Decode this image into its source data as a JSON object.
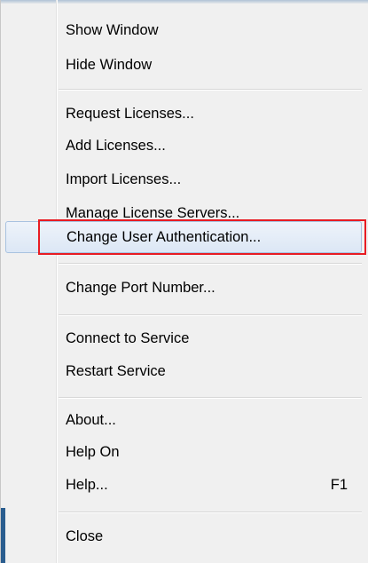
{
  "menu": {
    "items": {
      "show_window": "Show Window",
      "hide_window": "Hide Window",
      "request_licenses": "Request Licenses...",
      "add_licenses": "Add Licenses...",
      "import_licenses": "Import Licenses...",
      "manage_license_servers": "Manage License Servers...",
      "change_user_auth": "Change User Authentication...",
      "change_port_number": "Change Port Number...",
      "connect_to_service": "Connect to Service",
      "restart_service": "Restart Service",
      "about": "About...",
      "help_on": "Help On",
      "help": "Help...",
      "help_shortcut": "F1",
      "close": "Close"
    }
  },
  "colors": {
    "highlight_border": "#e81c23",
    "menu_background": "#f0f0f0"
  }
}
